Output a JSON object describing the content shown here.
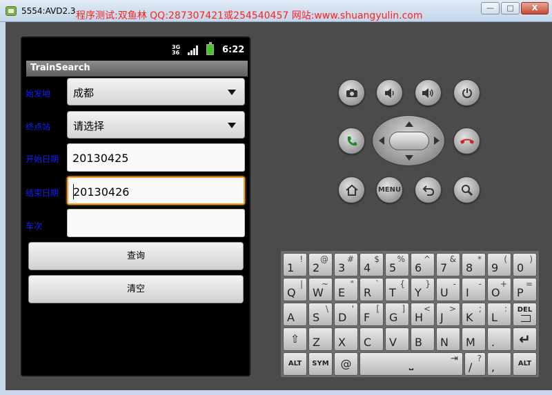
{
  "window": {
    "title": "5554:AVD2.3",
    "watermark": "程序测试:双鱼林 QQ:287307421或254540457 网站:www.shuangyulin.com",
    "min_label": "—",
    "max_label": "□",
    "close_label": "X"
  },
  "status": {
    "network": "3G",
    "network2": "36",
    "time": "6:22"
  },
  "app": {
    "title": "TrainSearch",
    "start_label": "始发地",
    "start_value": "成都",
    "end_label": "终点站",
    "end_value": "请选择",
    "date_start_label": "开始日期",
    "date_start_value": "20130425",
    "date_end_label": "结束日期",
    "date_end_value": "20130426",
    "train_label": "车次",
    "train_value": "",
    "query_button": "查询",
    "clear_button": "清空"
  },
  "controls": {
    "menu_label": "MENU"
  },
  "keyboard": {
    "row1": [
      {
        "m": "1",
        "s": "!"
      },
      {
        "m": "2",
        "s": "@"
      },
      {
        "m": "3",
        "s": "#"
      },
      {
        "m": "4",
        "s": "$"
      },
      {
        "m": "5",
        "s": "%"
      },
      {
        "m": "6",
        "s": "^"
      },
      {
        "m": "7",
        "s": "&"
      },
      {
        "m": "8",
        "s": "*"
      },
      {
        "m": "9",
        "s": "("
      },
      {
        "m": "0",
        "s": ")"
      }
    ],
    "row2": [
      {
        "m": "Q",
        "s": "|"
      },
      {
        "m": "W",
        "s": "~"
      },
      {
        "m": "E",
        "s": "\""
      },
      {
        "m": "R",
        "s": "`"
      },
      {
        "m": "T",
        "s": "{"
      },
      {
        "m": "Y",
        "s": "}"
      },
      {
        "m": "U",
        "s": "-"
      },
      {
        "m": "I",
        "s": "-"
      },
      {
        "m": "O",
        "s": "+"
      },
      {
        "m": "P",
        "s": "="
      }
    ],
    "row3": [
      {
        "m": "A",
        "s": ""
      },
      {
        "m": "S",
        "s": "\\"
      },
      {
        "m": "D",
        "s": "'"
      },
      {
        "m": "F",
        "s": "["
      },
      {
        "m": "G",
        "s": "]"
      },
      {
        "m": "H",
        "s": "<"
      },
      {
        "m": "J",
        "s": ">"
      },
      {
        "m": "K",
        "s": ";"
      },
      {
        "m": "L",
        "s": ":"
      }
    ],
    "del_label": "DEL",
    "row4": [
      {
        "m": "Z",
        "s": ""
      },
      {
        "m": "X",
        "s": ""
      },
      {
        "m": "C",
        "s": ""
      },
      {
        "m": "V",
        "s": ""
      },
      {
        "m": "B",
        "s": ""
      },
      {
        "m": "N",
        "s": ""
      },
      {
        "m": "M",
        "s": ""
      },
      {
        "m": ".",
        "s": ""
      }
    ],
    "alt_label": "ALT",
    "sym_label": "SYM",
    "at_label": "@",
    "slash_label": "/",
    "slash_sub": "?",
    "comma_label": ",",
    "comma_sub": ""
  }
}
